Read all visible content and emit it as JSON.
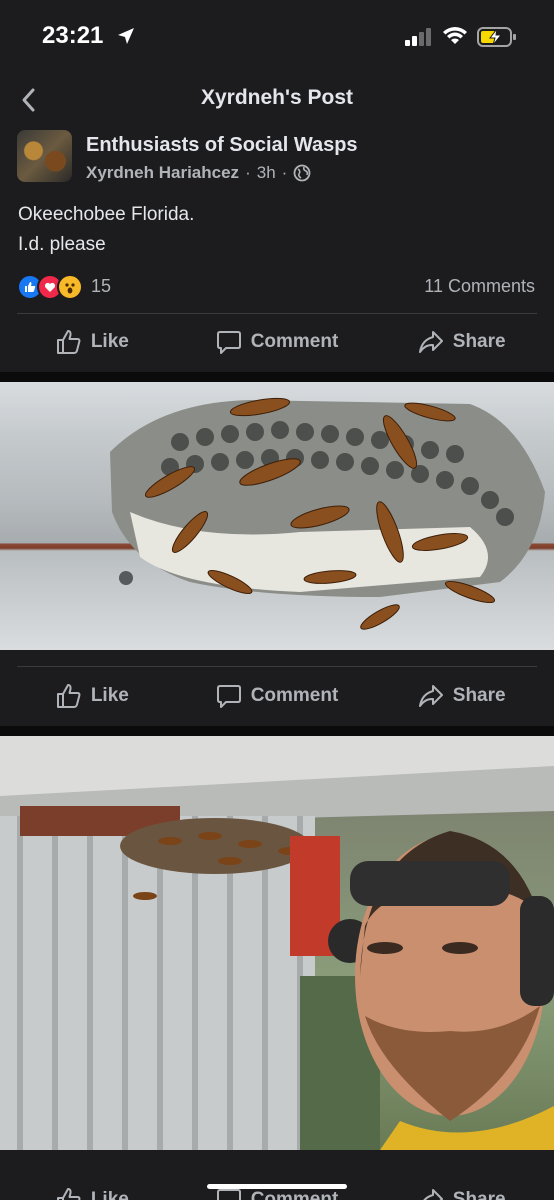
{
  "status": {
    "time": "23:21"
  },
  "nav": {
    "title": "Xyrdneh's Post"
  },
  "post": {
    "group_name": "Enthusiasts of Social Wasps",
    "author": "Xyrdneh Hariahcez",
    "time_ago": "3h",
    "text_line1": "Okeechobee Florida.",
    "text_line2": "I.d. please",
    "reaction_count": "15",
    "comment_count": "11 Comments"
  },
  "actions": {
    "like": "Like",
    "comment": "Comment",
    "share": "Share"
  },
  "colors": {
    "background": "#1c1c1e",
    "text_primary": "#e4e6eb",
    "text_secondary": "#b0b3b8",
    "like_blue": "#1877f2",
    "love_red": "#f02849",
    "wow_yellow": "#f7b928"
  }
}
